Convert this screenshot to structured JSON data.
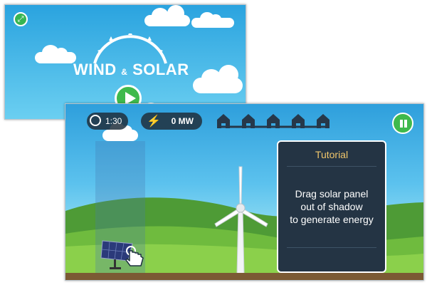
{
  "title_screen": {
    "logo_word_1": "WIND",
    "logo_amp": "&",
    "logo_word_2": "SOLAR",
    "play_icon": "play-icon",
    "expand_icon": "expand-icon"
  },
  "game": {
    "timer": "1:30",
    "timer_icon": "stopwatch-icon",
    "energy": "0 MW",
    "energy_icon": "lightning-bolt-icon",
    "houses_count": 5,
    "pause_icon": "pause-icon",
    "tutorial": {
      "title": "Tutorial",
      "line1": "Drag solar panel",
      "line2": "out of shadow",
      "line3": "to generate energy"
    }
  },
  "colors": {
    "sky": "#2e9fdc",
    "button_green": "#3fb94c",
    "tutorial_bg": "#243444",
    "tutorial_title": "#f0c66b",
    "bolt": "#f7c21a",
    "house": "#26384a"
  }
}
